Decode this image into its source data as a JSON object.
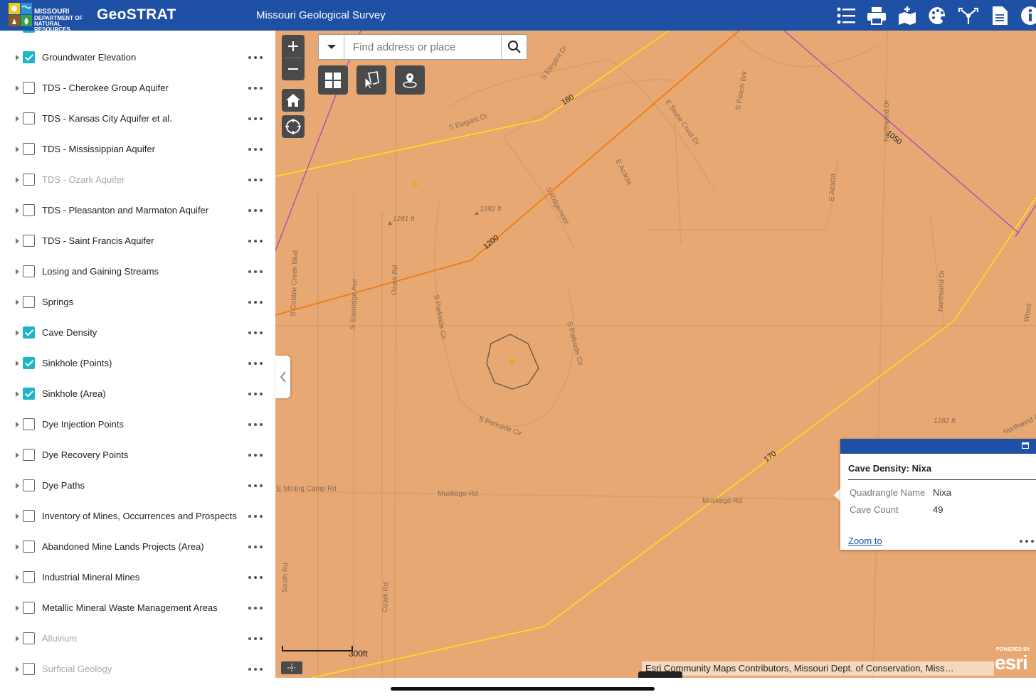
{
  "header": {
    "logo_line1": "MISSOURI",
    "logo_line2": "DEPARTMENT OF",
    "logo_line3": "NATURAL RESOURCES",
    "app_title": "GeoSTRAT",
    "org_title": "Missouri Geological Survey",
    "toolbar_icons": [
      "layer-list-icon",
      "print-icon",
      "basemap-gallery-icon",
      "legend-icon",
      "share-icon",
      "document-icon",
      "info-icon"
    ]
  },
  "layers": [
    {
      "label": "Groundwater Elevation",
      "checked": true,
      "dim": false
    },
    {
      "label": "TDS - Cherokee Group Aquifer",
      "checked": false,
      "dim": false
    },
    {
      "label": "TDS - Kansas City Aquifer et al.",
      "checked": false,
      "dim": false
    },
    {
      "label": "TDS - Mississippian Aquifer",
      "checked": false,
      "dim": false
    },
    {
      "label": "TDS - Ozark Aquifer",
      "checked": false,
      "dim": true
    },
    {
      "label": "TDS - Pleasanton and Marmaton Aquifer",
      "checked": false,
      "dim": false
    },
    {
      "label": "TDS - Saint Francis Aquifer",
      "checked": false,
      "dim": false
    },
    {
      "label": "Losing and Gaining Streams",
      "checked": false,
      "dim": false
    },
    {
      "label": "Springs",
      "checked": false,
      "dim": false
    },
    {
      "label": "Cave Density",
      "checked": true,
      "dim": false
    },
    {
      "label": "Sinkhole (Points)",
      "checked": true,
      "dim": false
    },
    {
      "label": "Sinkhole (Area)",
      "checked": true,
      "dim": false
    },
    {
      "label": "Dye Injection Points",
      "checked": false,
      "dim": false
    },
    {
      "label": "Dye Recovery Points",
      "checked": false,
      "dim": false
    },
    {
      "label": "Dye Paths",
      "checked": false,
      "dim": false
    },
    {
      "label": "Inventory of Mines, Occurrences and Prospects",
      "checked": false,
      "dim": false
    },
    {
      "label": "Abandoned Mine Lands Projects (Area)",
      "checked": false,
      "dim": false
    },
    {
      "label": "Industrial Mineral Mines",
      "checked": false,
      "dim": false
    },
    {
      "label": "Metallic Mineral Waste Management Areas",
      "checked": false,
      "dim": false
    },
    {
      "label": "Alluvium",
      "checked": false,
      "dim": true
    },
    {
      "label": "Surficial Geology",
      "checked": false,
      "dim": true
    }
  ],
  "search": {
    "placeholder": "Find address or place"
  },
  "map_labels": {
    "contour_180": "180",
    "contour_1200": "1200",
    "contour_1050": "1050",
    "contour_170": "170",
    "elev_1281": "1281 ft",
    "elev_1282a": "1282 ft",
    "elev_1282b": "1282 ft",
    "s_elegant_dr_1": "S Elegant Dr",
    "s_elegant_dr_2": "S Elegant Dr",
    "s_peach_brk": "S Peach Brk",
    "e_stone_crest_dr": "E Stone Crest Dr",
    "northwind_dr_1": "Northwind Dr",
    "northwind_dr_2": "Northwind Dr",
    "e_acacia_1": "E Acacia",
    "e_acacia_2": "E Acacia",
    "s_ridgemont": "S Ridgemont",
    "s_cobble_creek_blvd": "S Cobble Creek Blvd",
    "s_eastridge_ave": "S Eastridge Ave",
    "ozark_rd_1": "Ozark Rd",
    "ozark_rd_2": "Ozark Rd",
    "s_parkside_cir_1": "S Parkside Cir",
    "s_parkside_cir_2": "S Parkside Cir",
    "s_parkside_cir_3": "S Parkside Cir",
    "e_mining_camp_rd": "E Mining Camp Rd",
    "muskego_rd_1": "Muskego-Rd",
    "muskego_rd_2": "Muskego Rd",
    "south_rd": "South Rd",
    "wood_partial": "Wood",
    "northwind_partial": "Northwind Dr"
  },
  "popup": {
    "title": "Cave Density: Nixa",
    "fields": [
      {
        "key": "Quadrangle Name",
        "value": "Nixa"
      },
      {
        "key": "Cave Count",
        "value": "49"
      }
    ],
    "zoom_link": "Zoom to"
  },
  "scale": {
    "label": "300ft"
  },
  "attribution": "Esri Community Maps Contributors, Missouri Dept. of Conservation, Miss…",
  "esri": {
    "powered": "POWERED BY",
    "brand": "esri"
  },
  "colors": {
    "header": "#1e50a6",
    "map_fill": "#e8a873",
    "checkbox_on": "#1fb5c9",
    "contour_yellow": "#ffe11a",
    "contour_orange": "#f07a10",
    "contour_purple": "#b04ab0"
  }
}
